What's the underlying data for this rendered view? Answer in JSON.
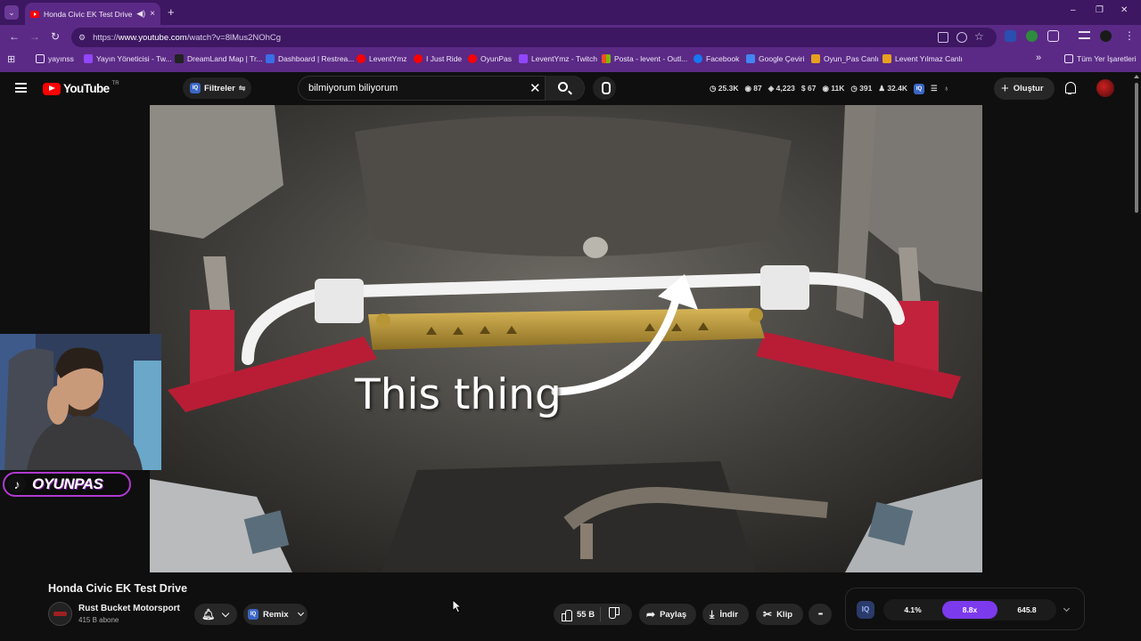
{
  "browser": {
    "tab_title": "Honda Civic EK Test Drive -",
    "tab_close": "×",
    "new_tab": "+",
    "url_prefix": "https://",
    "url_host": "www.youtube.com",
    "url_path": "/watch?v=8lMus2NOhCg",
    "window_min": "–",
    "window_restore": "❐",
    "window_close": "✕",
    "bookmarks": [
      {
        "label": "yayınss",
        "color": "#f0f0f0"
      },
      {
        "label": "Yayın Yöneticisi - Tw...",
        "color": "#9146ff"
      },
      {
        "label": "DreamLand Map | Tr...",
        "color": "#222222"
      },
      {
        "label": "Dashboard | Restrea...",
        "color": "#3a6ee8"
      },
      {
        "label": "LeventYmz",
        "color": "#ff0000"
      },
      {
        "label": "I Just Ride",
        "color": "#ff0000"
      },
      {
        "label": "OyunPas",
        "color": "#ff0000"
      },
      {
        "label": "LeventYmz - Twitch",
        "color": "#9146ff"
      },
      {
        "label": "Posta - levent - Outl...",
        "color": "#f25022"
      },
      {
        "label": "Facebook",
        "color": "#1877f2"
      },
      {
        "label": "Google Çeviri",
        "color": "#4285f4"
      },
      {
        "label": "Oyun_Pas Canlı",
        "color": "#e8a020"
      },
      {
        "label": "Levent Yılmaz Canlı",
        "color": "#e8a020"
      }
    ],
    "bookmarks_more": "»",
    "all_bookmarks": "Tüm Yer İşaretleri"
  },
  "youtube": {
    "logo_text": "YouTube",
    "country": "TR",
    "filters_label": "Filtreler",
    "search_value": "bilmiyorum biliyorum",
    "clear_glyph": "✕",
    "stats": [
      "25.3K",
      "87",
      "4,223",
      "67",
      "11K",
      "391",
      "32.4K"
    ],
    "create_label": "Oluştur",
    "create_glyph": "+"
  },
  "video": {
    "overlay_text": "This thing",
    "streamer_tag": "OYUNPAS",
    "tiktok_glyph": "♪"
  },
  "meta": {
    "title": "Honda Civic EK Test Drive",
    "channel": "Rust Bucket Motorsport",
    "subscribers": "415 B abone",
    "remix_label": "Remix",
    "likes": "55 B",
    "share_label": "Paylaş",
    "download_label": "İndir",
    "clip_label": "Klip",
    "more_glyph": "•••"
  },
  "iq_panel": {
    "badge": "IQ",
    "values": [
      "4.1%",
      "8.8x",
      "645.8"
    ],
    "active_index": 1,
    "accent": "#7c3aed"
  }
}
